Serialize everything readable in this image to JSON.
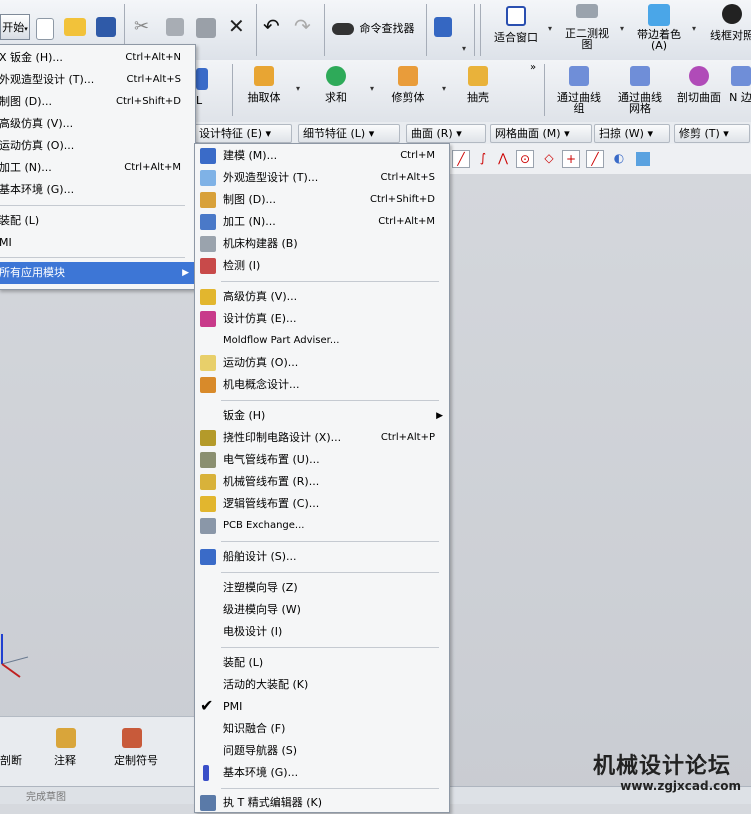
{
  "toolbar_top": {
    "start_label": "开始",
    "find_command": "命令查找器",
    "fit": "适合窗口",
    "trimetric": "正二测视图",
    "shaded": "带边着色 (A)",
    "wireframe": "线框对照"
  },
  "toolbar_feature": {
    "extract": "抽取体",
    "sum": "求和",
    "trim": "修剪体",
    "shell": "抽壳",
    "thru_curves": "通过曲线组",
    "thru_mesh": "通过曲线网格",
    "section": "剖切曲面",
    "n_face": "N 边"
  },
  "menu_groups": [
    "设计特征 (E) ▾",
    "细节特征 (L) ▾",
    "曲面 (R) ▾",
    "网格曲面 (M) ▾",
    "扫掠 (W) ▾",
    "修剪 (T) ▾"
  ],
  "left_menu": [
    {
      "label": "X 钣金 (H)...",
      "shortcut": "Ctrl+Alt+N"
    },
    {
      "label": "外观造型设计 (T)...",
      "shortcut": "Ctrl+Alt+S"
    },
    {
      "label": "制图 (D)...",
      "shortcut": "Ctrl+Shift+D"
    },
    {
      "label": "高级仿真 (V)...",
      "shortcut": ""
    },
    {
      "label": "运动仿真 (O)...",
      "shortcut": ""
    },
    {
      "label": "加工 (N)...",
      "shortcut": "Ctrl+Alt+M"
    },
    {
      "label": "基本环境 (G)...",
      "shortcut": ""
    },
    {
      "label": "装配 (L)",
      "shortcut": ""
    },
    {
      "label": "MI",
      "shortcut": ""
    },
    {
      "label": "所有应用模块",
      "shortcut": ""
    }
  ],
  "sub_menu": [
    {
      "label": "建模 (M)...",
      "shortcut": "Ctrl+M"
    },
    {
      "label": "外观造型设计 (T)...",
      "shortcut": "Ctrl+Alt+S"
    },
    {
      "label": "制图 (D)...",
      "shortcut": "Ctrl+Shift+D"
    },
    {
      "label": "加工 (N)...",
      "shortcut": "Ctrl+Alt+M"
    },
    {
      "label": "机床构建器 (B)",
      "shortcut": ""
    },
    {
      "label": "检测 (I)",
      "shortcut": ""
    },
    {
      "label": "高级仿真 (V)...",
      "shortcut": ""
    },
    {
      "label": "设计仿真 (E)...",
      "shortcut": ""
    },
    {
      "label": "Moldflow Part Adviser...",
      "shortcut": ""
    },
    {
      "label": "运动仿真 (O)...",
      "shortcut": ""
    },
    {
      "label": "机电概念设计...",
      "shortcut": ""
    },
    {
      "label": "钣金 (H)",
      "shortcut": ""
    },
    {
      "label": "挠性印制电路设计 (X)...",
      "shortcut": "Ctrl+Alt+P"
    },
    {
      "label": "电气管线布置 (U)...",
      "shortcut": ""
    },
    {
      "label": "机械管线布置 (R)...",
      "shortcut": ""
    },
    {
      "label": "逻辑管线布置 (C)...",
      "shortcut": ""
    },
    {
      "label": "PCB Exchange...",
      "shortcut": ""
    },
    {
      "label": "船舶设计 (S)...",
      "shortcut": ""
    },
    {
      "label": "注塑模向导 (Z)",
      "shortcut": ""
    },
    {
      "label": "级进模向导 (W)",
      "shortcut": ""
    },
    {
      "label": "电极设计 (I)",
      "shortcut": ""
    },
    {
      "label": "装配 (L)",
      "shortcut": ""
    },
    {
      "label": "活动的大装配 (K)",
      "shortcut": ""
    },
    {
      "label": "PMI",
      "shortcut": ""
    },
    {
      "label": "知识融合 (F)",
      "shortcut": ""
    },
    {
      "label": "问题导航器 (S)",
      "shortcut": ""
    },
    {
      "label": "基本环境 (G)...",
      "shortcut": ""
    },
    {
      "label": "执 T 精式编辑器 (K)",
      "shortcut": ""
    }
  ],
  "bottom_toolbar": {
    "cut": "剖断",
    "note": "注释",
    "custom_symbol": "定制符号",
    "finish_sketch": "完成草图"
  },
  "watermark": {
    "title": "机械设计论坛",
    "url": "www.zgjxcad.com"
  },
  "colors": {
    "highlight": "#3d76d6",
    "menu_bg": "#f5f6f7"
  }
}
